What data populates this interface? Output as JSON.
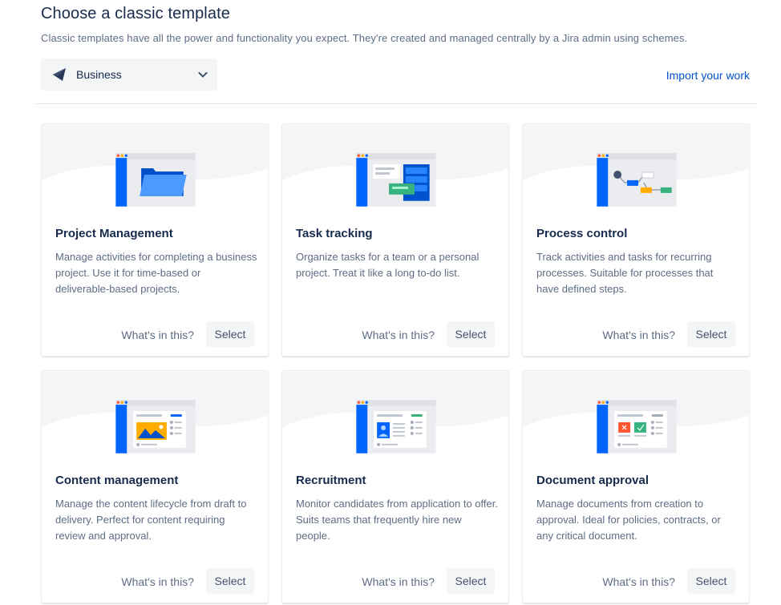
{
  "header": {
    "title": "Choose a classic template",
    "subtitle": "Classic templates have all the power and functionality you expect. They're created and managed centrally by a Jira admin using schemes."
  },
  "category": {
    "selected": "Business",
    "icon": "business-icon"
  },
  "import_link": "Import your work",
  "templates": [
    {
      "title": "Project Management",
      "description": "Manage activities for completing a business project. Use it for time-based or deliverable-based projects.",
      "whats_label": "What's in this?",
      "select_label": "Select",
      "illustration": "folder-illustration"
    },
    {
      "title": "Task tracking",
      "description": "Organize tasks for a team or a personal project. Treat it like a long to-do list.",
      "whats_label": "What's in this?",
      "select_label": "Select",
      "illustration": "board-illustration"
    },
    {
      "title": "Process control",
      "description": "Track activities and tasks for recurring processes. Suitable for processes that have defined steps.",
      "whats_label": "What's in this?",
      "select_label": "Select",
      "illustration": "workflow-illustration"
    },
    {
      "title": "Content management",
      "description": "Manage the content lifecycle from draft to delivery. Perfect for content requiring review and approval.",
      "whats_label": "What's in this?",
      "select_label": "Select",
      "illustration": "content-illustration"
    },
    {
      "title": "Recruitment",
      "description": "Monitor candidates from application to offer. Suits teams that frequently hire new people.",
      "whats_label": "What's in this?",
      "select_label": "Select",
      "illustration": "recruitment-illustration"
    },
    {
      "title": "Document approval",
      "description": "Manage documents from creation to approval. Ideal for policies, contracts, or any critical document.",
      "whats_label": "What's in this?",
      "select_label": "Select",
      "illustration": "document-illustration"
    }
  ],
  "colors": {
    "primary": "#0052CC",
    "text": "#172B4D",
    "subtle": "#5E6C84",
    "button_bg": "#F4F5F7"
  }
}
